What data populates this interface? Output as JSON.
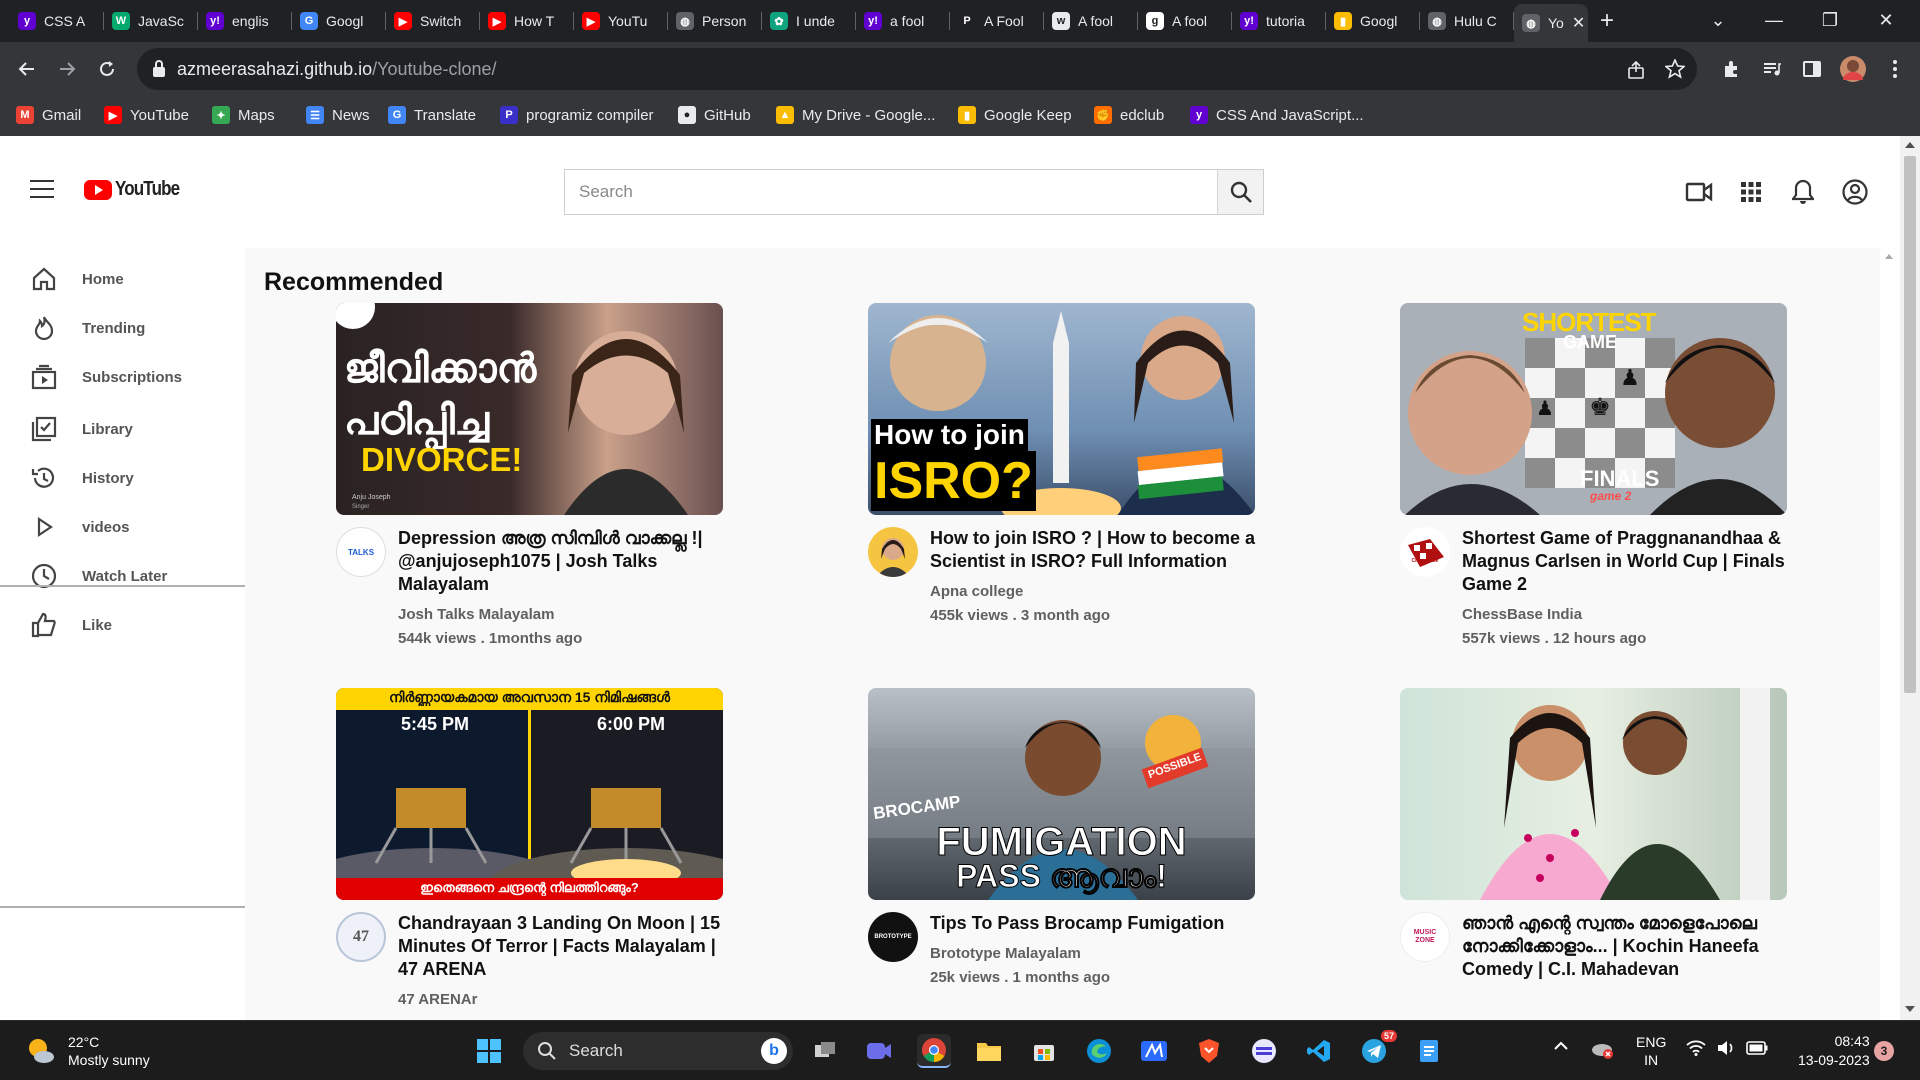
{
  "browser": {
    "tabs": [
      {
        "title": "CSS A",
        "favicon": "yahoo-icon",
        "color": "#6001d2",
        "glyph": "y"
      },
      {
        "title": "JavaSc",
        "favicon": "w3schools-icon",
        "color": "#04aa6d",
        "glyph": "W"
      },
      {
        "title": "englis",
        "favicon": "yahoo-icon",
        "color": "#6001d2",
        "glyph": "y!"
      },
      {
        "title": "Googl",
        "favicon": "google-translate-icon",
        "color": "#4285f4",
        "glyph": "G"
      },
      {
        "title": "Switch",
        "favicon": "youtube-icon",
        "color": "#ff0000",
        "glyph": "▶"
      },
      {
        "title": "How T",
        "favicon": "youtube-icon",
        "color": "#ff0000",
        "glyph": "▶"
      },
      {
        "title": "YouTu",
        "favicon": "youtube-icon",
        "color": "#ff0000",
        "glyph": "▶"
      },
      {
        "title": "Person",
        "favicon": "globe-icon",
        "color": "#5f6368",
        "glyph": "◍"
      },
      {
        "title": "I unde",
        "favicon": "chatgpt-icon",
        "color": "#10a37f",
        "glyph": "✿"
      },
      {
        "title": "a fool",
        "favicon": "yahoo-icon",
        "color": "#6001d2",
        "glyph": "y!"
      },
      {
        "title": "A Fool",
        "favicon": "p-icon",
        "color": "#202124",
        "glyph": "P"
      },
      {
        "title": "A fool",
        "favicon": "www-icon",
        "color": "#e8eaed",
        "glyph": "w"
      },
      {
        "title": "A fool",
        "favicon": "g-icon",
        "color": "#ffffff",
        "glyph": "g"
      },
      {
        "title": "tutoria",
        "favicon": "yahoo-icon",
        "color": "#6001d2",
        "glyph": "y!"
      },
      {
        "title": "Googl",
        "favicon": "google-keep-icon",
        "color": "#fbbc04",
        "glyph": "▮"
      },
      {
        "title": "Hulu C",
        "favicon": "globe-icon",
        "color": "#5f6368",
        "glyph": "◍"
      },
      {
        "title": "Yo",
        "favicon": "globe-icon",
        "color": "#5f6368",
        "glyph": "◍",
        "active": true
      }
    ],
    "close_glyph": "✕",
    "new_tab_glyph": "+",
    "window_controls": {
      "menu": "⌄",
      "minimize": "—",
      "restore": "❐",
      "close": "✕"
    },
    "url_host": "azmeerasahazi.github.io",
    "url_path": "/Youtube-clone/",
    "bookmarks": [
      {
        "label": "Gmail",
        "icon": "gmail-icon",
        "color": "#ea4335",
        "glyph": "M"
      },
      {
        "label": "YouTube",
        "icon": "youtube-icon",
        "color": "#ff0000",
        "glyph": "▶"
      },
      {
        "label": "Maps",
        "icon": "maps-icon",
        "color": "#34a853",
        "glyph": "✦"
      },
      {
        "label": "News",
        "icon": "news-icon",
        "color": "#4285f4",
        "glyph": "☰"
      },
      {
        "label": "Translate",
        "icon": "google-translate-icon",
        "color": "#4285f4",
        "glyph": "G"
      },
      {
        "label": "programiz compiler",
        "icon": "programiz-icon",
        "color": "#3b2fc9",
        "glyph": "P"
      },
      {
        "label": "GitHub",
        "icon": "github-icon",
        "color": "#e8eaed",
        "glyph": "●"
      },
      {
        "label": "My Drive - Google...",
        "icon": "google-drive-icon",
        "color": "#fbbc04",
        "glyph": "▲"
      },
      {
        "label": "Google Keep",
        "icon": "google-keep-icon",
        "color": "#fbbc04",
        "glyph": "▮"
      },
      {
        "label": "edclub",
        "icon": "edclub-icon",
        "color": "#ff6d00",
        "glyph": "✊"
      },
      {
        "label": "CSS And JavaScript...",
        "icon": "yahoo-icon",
        "color": "#6001d2",
        "glyph": "y"
      }
    ]
  },
  "youtube": {
    "logo_text": "YouTube",
    "search_placeholder": "Search",
    "sidebar": [
      {
        "label": "Home",
        "icon": "home-icon"
      },
      {
        "label": "Trending",
        "icon": "trending-icon"
      },
      {
        "label": "Subscriptions",
        "icon": "subscriptions-icon"
      },
      {
        "label": "Library",
        "icon": "library-icon"
      },
      {
        "label": "History",
        "icon": "history-icon"
      },
      {
        "label": "videos",
        "icon": "play-icon"
      },
      {
        "label": "Watch Later",
        "icon": "clock-icon"
      },
      {
        "label": "Like",
        "icon": "thumbs-up-icon"
      }
    ],
    "section_title": "Recommended",
    "videos": [
      {
        "title": "Depression അത്ര സിമ്പിൾ വാക്കല്ല !| @anjujoseph1075 | Josh Talks Malayalam",
        "channel": "Josh Talks Malayalam",
        "meta": "544k views . 1months ago",
        "thumb_text": "ജീവിക്കാൻ പഠിപ്പിച്ച",
        "thumb_text2": "DIVORCE!",
        "thumb_caption": "Anju Joseph",
        "thumb_caption2": "Singer",
        "avatar_text": "TALKS"
      },
      {
        "title": "How to join ISRO ? | How to become a Scientist in ISRO? Full Information",
        "channel": "Apna college",
        "meta": "455k views . 3 month ago",
        "thumb_text": "How to join",
        "thumb_text2": "ISRO?",
        "avatar_text": ""
      },
      {
        "title": "Shortest Game of Praggnanandhaa & Magnus Carlsen in World Cup | Finals Game 2",
        "channel": "ChessBase India",
        "meta": "557k views . 12 hours ago",
        "thumb_text": "SHORTEST",
        "thumb_text2": "GAME",
        "thumb_caption": "FINALS",
        "thumb_caption2": "game 2",
        "avatar_text": "ChessBase"
      },
      {
        "title": "Chandrayaan 3 Landing On Moon | 15 Minutes Of Terror | Facts Malayalam | 47 ARENA",
        "channel": "47 ARENAr",
        "meta": "",
        "thumb_text": "നിർണ്ണായകമായ അവസാന 15 നിമിഷങ്ങൾ",
        "thumb_text2": "5:45 PM",
        "thumb_caption": "6:00 PM",
        "thumb_caption2": "ഇതെങ്ങനെ ചന്ദ്രന്റെ നിലത്തിറങ്ങും?",
        "avatar_text": "47"
      },
      {
        "title": "Tips To Pass Brocamp Fumigation",
        "channel": "Brototype Malayalam",
        "meta": "25k views . 1 months ago",
        "thumb_text": "BROCAMP",
        "thumb_text2": "FUMIGATION",
        "thumb_caption": "PASS ആവാം!",
        "thumb_caption2": "POSSIBLE",
        "avatar_text": "BROTOTYPE"
      },
      {
        "title": "ഞാൻ എന്റെ സ്വന്തം മോളെപോലെ നോക്കിക്കോളാം... | Kochin Haneefa Comedy | C.I. Mahadevan",
        "channel": "",
        "meta": "",
        "thumb_text": "",
        "thumb_text2": "",
        "avatar_text": "MUSIC ZONE"
      }
    ]
  },
  "taskbar": {
    "temperature": "22°C",
    "weather": "Mostly sunny",
    "search_label": "Search",
    "lang": "ENG",
    "region": "IN",
    "time": "08:43",
    "date": "13-09-2023",
    "notif_count": "3",
    "telegram_badge": "57"
  }
}
